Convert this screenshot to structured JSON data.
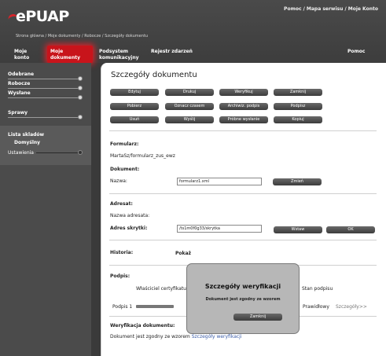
{
  "header": {
    "logo_text": "ePUAP",
    "links": [
      "Pomoc",
      "Mapa serwisu",
      "Moje Konto"
    ],
    "breadcrumb": [
      "Strona główna",
      "Moje dokumenty",
      "Robocze",
      "Szczegóły dokumentu"
    ]
  },
  "nav": {
    "tabs": [
      "Moje konto",
      "Moje dokumenty",
      "Podsystem komunikacyjny",
      "Rejestr zdarzeń",
      "Pomoc"
    ],
    "active_tab": "Moje dokumenty"
  },
  "sidebar": {
    "items": [
      "Odebrane",
      "Robocze",
      "Wysłane",
      "Sprawy"
    ],
    "lists_title": "Lista skladów",
    "lists_default": "Domyślny",
    "settings": "Ustawienia"
  },
  "main": {
    "title": "Szczegóły dokumentu",
    "buttons_row1": [
      "Edytuj",
      "Drukuj",
      "Weryfikuj",
      "Zamknij"
    ],
    "buttons_row2": [
      "Pobierz",
      "Oznacz czasem",
      "Archiwiz. podpis",
      "Podpisz"
    ],
    "buttons_row3": [
      "Usuń",
      "Wyślij",
      "Próbne wysłanie",
      "Kopiuj"
    ],
    "formularz_label": "Formularz:",
    "formularz_value": "MartaSz/formularz_zus_ewz",
    "dokument_label": "Dokument:",
    "nazwa_label": "Nazwa:",
    "nazwa_value": "formularz1.xml",
    "zmien_button": "Zmień",
    "adresat_label": "Adresat:",
    "nazwa_adresata_label": "Nazwa adresata:",
    "adres_skrytki_label": "Adres skrytki:",
    "adres_skrytki_value": "/ts1m0f0g33/skrytka",
    "wstaw_button": "Wstaw",
    "ok_button": "OK",
    "historia_label": "Historia:",
    "pokaz_link": "Pokaż",
    "podpis_label": "Podpis:",
    "wlasciciel_header": "Właściciel certyfikatu",
    "stan_header": "Stan podpisu",
    "podpis_row_label": "Podpis 1",
    "podpis_row_status": "Prawidłowy",
    "szczegoly_link": "Szczegóły>>",
    "weryfikacja_label": "Weryfikacja dokumentu:",
    "weryfikacja_text": "Dokument jest zgodny ze wzorem",
    "weryfikacja_link": "Szczegóły weryfikacji"
  },
  "modal": {
    "title": "Szczegóły weryfikacji",
    "message": "Dokument jest zgodny ze wzorem",
    "close_button": "Zamknij"
  },
  "colors": {
    "accent": "#c8141b",
    "button_dark": "#4a4a4a",
    "background": "#3a3a3a"
  }
}
